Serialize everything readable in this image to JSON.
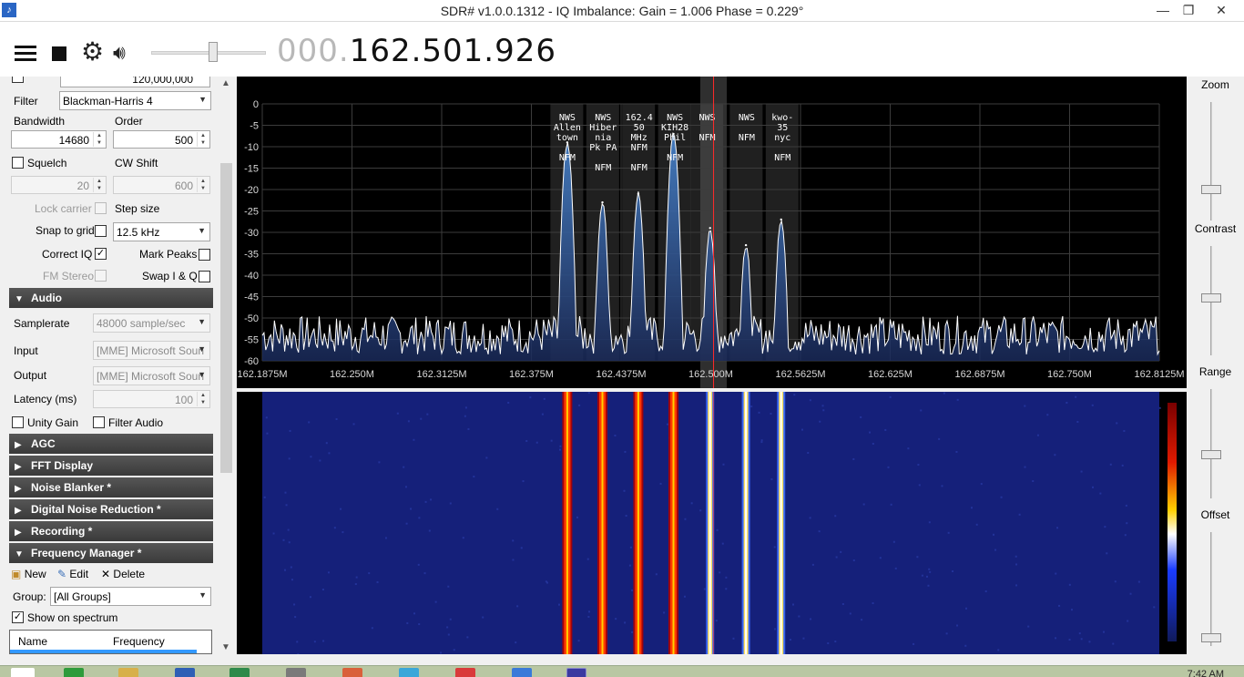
{
  "window": {
    "title": "SDR# v1.0.0.1312 - IQ Imbalance: Gain = 1.006 Phase = 0.229°",
    "minimize": "—",
    "restore": "❐",
    "close": "✕"
  },
  "toolbar": {
    "frequency_dim": "000.",
    "frequency_main": "162.501.926",
    "volume_fraction": 0.55
  },
  "radio": {
    "shift_value": "120,000,000",
    "filter_label": "Filter",
    "filter_value": "Blackman-Harris 4",
    "bandwidth_label": "Bandwidth",
    "bandwidth_value": "14680",
    "order_label": "Order",
    "order_value": "500",
    "squelch_label": "Squelch",
    "squelch_value": "20",
    "cw_shift_label": "CW Shift",
    "cw_shift_value": "600",
    "lock_carrier_label": "Lock carrier",
    "step_size_label": "Step size",
    "snap_label": "Snap to grid",
    "step_value": "12.5 kHz",
    "correct_iq_label": "Correct IQ",
    "correct_iq_check": "✓",
    "mark_peaks_label": "Mark Peaks",
    "fm_stereo_label": "FM Stereo",
    "swap_iq_label": "Swap I & Q"
  },
  "audio": {
    "header": "Audio",
    "samplerate_label": "Samplerate",
    "samplerate_value": "48000 sample/sec",
    "input_label": "Input",
    "input_value": "[MME] Microsoft Soun",
    "output_label": "Output",
    "output_value": "[MME] Microsoft Soun",
    "latency_label": "Latency (ms)",
    "latency_value": "100",
    "unity_gain_label": "Unity Gain",
    "filter_audio_label": "Filter Audio"
  },
  "sections": [
    {
      "label": "AGC",
      "expanded": false
    },
    {
      "label": "FFT Display",
      "expanded": false
    },
    {
      "label": "Noise Blanker *",
      "expanded": false
    },
    {
      "label": "Digital Noise Reduction *",
      "expanded": false
    },
    {
      "label": "Recording *",
      "expanded": false
    },
    {
      "label": "Frequency Manager *",
      "expanded": true
    }
  ],
  "freq_manager": {
    "new_label": "New",
    "edit_label": "Edit",
    "delete_label": "Delete",
    "group_label": "Group:",
    "group_value": "[All Groups]",
    "show_label": "Show on spectrum",
    "show_check": "✓",
    "col_name": "Name",
    "col_frequency": "Frequency"
  },
  "right_panel": {
    "zoom_label": "Zoom",
    "contrast_label": "Contrast",
    "range_label": "Range",
    "offset_label": "Offset"
  },
  "taskbar": {
    "clock": "7:42 AM"
  },
  "icons": {
    "menu": "hamburger-icon",
    "stop": "stop-icon",
    "settings": "gear-icon",
    "audio": "speaker-icon"
  },
  "chart_data": {
    "type": "line",
    "x_ticks": [
      "162.1875M",
      "162.250M",
      "162.3125M",
      "162.375M",
      "162.4375M",
      "162.500M",
      "162.5625M",
      "162.625M",
      "162.6875M",
      "162.750M",
      "162.8125M"
    ],
    "x_tick_values": [
      162.1875,
      162.25,
      162.3125,
      162.375,
      162.4375,
      162.5,
      162.5625,
      162.625,
      162.6875,
      162.75,
      162.8125
    ],
    "y_ticks": [
      "0",
      "-5",
      "-10",
      "-15",
      "-20",
      "-25",
      "-30",
      "-35",
      "-40",
      "-45",
      "-50",
      "-55",
      "-60"
    ],
    "xlim": [
      162.1875,
      162.8125
    ],
    "ylim": [
      -60,
      0
    ],
    "noise_floor": -54,
    "tuned_frequency": 162.501926,
    "filter_bandwidth_mhz": 0.01468,
    "peaks": [
      {
        "x": 162.4,
        "y": -9
      },
      {
        "x": 162.4245,
        "y": -23
      },
      {
        "x": 162.4495,
        "y": -21
      },
      {
        "x": 162.474,
        "y": -7
      },
      {
        "x": 162.4995,
        "y": -29
      },
      {
        "x": 162.5245,
        "y": -33
      },
      {
        "x": 162.549,
        "y": -27
      }
    ],
    "markers": [
      {
        "lines": [
          "NWS",
          "Allen",
          "town",
          "",
          "NFM"
        ],
        "x": 162.4
      },
      {
        "lines": [
          "NWS",
          "Hiber",
          "nia",
          "Pk PA",
          "",
          "NFM"
        ],
        "x": 162.425
      },
      {
        "lines": [
          "162.4",
          "50",
          "MHz",
          "NFM",
          "",
          "NFM"
        ],
        "x": 162.45
      },
      {
        "lines": [
          "NWS",
          "KIH28",
          "Phil",
          "",
          "NFM"
        ],
        "x": 162.475
      },
      {
        "lines": [
          "NWS",
          "",
          "NFM"
        ],
        "x": 162.4975
      },
      {
        "lines": [
          "NWS",
          "",
          "NFM"
        ],
        "x": 162.525
      },
      {
        "lines": [
          "kwo-",
          "35",
          "nyc",
          "",
          "NFM"
        ],
        "x": 162.55
      }
    ],
    "grid": true
  }
}
